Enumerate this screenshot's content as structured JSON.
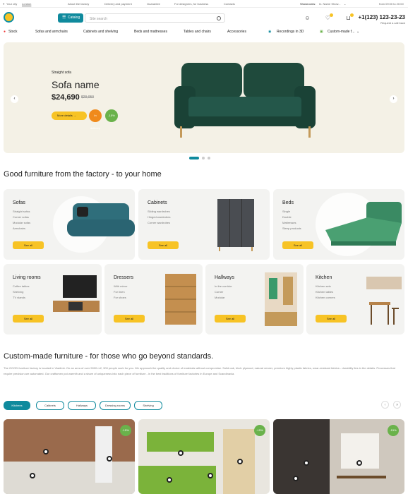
{
  "topbar": {
    "city_label": "Your city",
    "city": "London",
    "links": [
      "About the factory",
      "Delivery and payment",
      "Guarantee",
      "For designers, for business",
      "Contacts"
    ],
    "showrooms_label": "Showrooms:",
    "showroom_value": "In. Name Show...",
    "hours": "from 09:00 to 20:00"
  },
  "header": {
    "catalog_label": "Catalog",
    "search_placeholder": "Site search",
    "phone": "+1(123) 123-23-23",
    "callback": "Request a call back"
  },
  "nav": {
    "items": [
      "Stock",
      "Sofas and armchairs",
      "Cabinets and shelving",
      "Beds and mattresses",
      "Tables and chairs",
      "Accessories",
      "Recordings in 3D",
      "Custom-made f..."
    ]
  },
  "hero": {
    "subtitle": "Straight sofa",
    "title": "Sofa name",
    "price": "$24,690",
    "old_price": "$29,050",
    "more_label": "More details",
    "badge_orange": "In delivery",
    "badge_green": "-15%"
  },
  "section1": {
    "title": "Good furniture from the factory - to your home"
  },
  "categories": [
    {
      "title": "Sofas",
      "items": [
        "Straight sofas",
        "Corner sofas",
        "Modular sofas",
        "Armchairs"
      ],
      "button": "See all"
    },
    {
      "title": "Cabinets",
      "items": [
        "Sliding wardrobes",
        "Hinged wardrobes",
        "Corner wardrobes"
      ],
      "button": "See all"
    },
    {
      "title": "Beds",
      "items": [
        "Single",
        "Double",
        "Mattresses",
        "Sleep products"
      ],
      "button": "See all"
    },
    {
      "title": "Living rooms",
      "items": [
        "Coffee tables",
        "Shelving",
        "TV stands"
      ],
      "button": "See all"
    },
    {
      "title": "Dressers",
      "items": [
        "With mirror",
        "For linen",
        "For shoes"
      ],
      "button": "See all"
    },
    {
      "title": "Hallways",
      "items": [
        "In the corridor",
        "Corner",
        "Modular"
      ],
      "button": "See all"
    },
    {
      "title": "Kitchen",
      "items": [
        "Kitchen sets",
        "Kitchen tables",
        "Kitchen corners"
      ],
      "button": "See all"
    }
  ],
  "section2": {
    "title": "Custom-made furniture - for those who go beyond standards.",
    "paragraph": "The GOOD furniture factory is located in Vladimir. On an area of over 5000 m2, 300 people work for you. We approach the quality and choice of materials without compromise. Solid oak, birch plywood, natural veneer, premium highly plastic fabrics, wear-resistant fabrics - durability lies in the details. Processes that require precision are automated. Our craftsmen put warmth and a share of uniqueness into each piece of furniture - in the best traditions of furniture factories in Europe and Scandinavia."
  },
  "tabs": [
    "Kitchens",
    "Cabinets",
    "Hallways",
    "Dressing rooms",
    "Shelving"
  ],
  "products": [
    {
      "discount": "-15%"
    },
    {
      "discount": "-15%"
    },
    {
      "discount": "-15%"
    }
  ]
}
